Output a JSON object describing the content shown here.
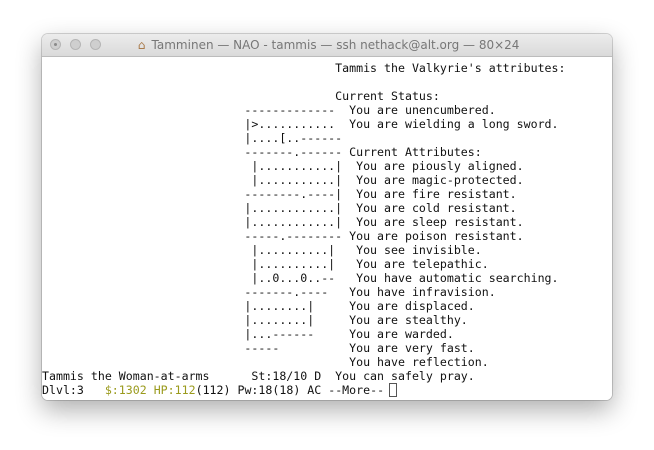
{
  "window": {
    "title": "Tamminen — NAO - tammis — ssh nethack@alt.org — 80×24",
    "title_icon": "home-folder-icon"
  },
  "terminal": {
    "lines": [
      "                                          Tammis the Valkyrie's attributes:",
      "",
      "                                          Current Status:",
      "                             -------------  You are unencumbered.",
      "                             |>...........  You are wielding a long sword.",
      "                             |....[..------",
      "                             -------.------ Current Attributes:",
      "                              |...........|  You are piously aligned.",
      "                              |...........|  You are magic-protected.",
      "                             --------.----|  You are fire resistant.",
      "                             |............|  You are cold resistant.",
      "                             |............|  You are sleep resistant.",
      "                             -----.-------- You are poison resistant.",
      "                              |..........|   You see invisible.",
      "                              |..........|   You are telepathic.",
      "                              |..0...0..--   You have automatic searching.",
      "                             -------.----   You have infravision.",
      "                             |........|     You are displaced.",
      "                             |........|     You are stealthy.",
      "                             |...------     You are warded.",
      "                             -----          You are very fast.",
      "                                            You have reflection.",
      "Tammis the Woman-at-arms      St:18/10 D  You can safely pray."
    ],
    "status": {
      "dlvl": "Dlvl:3   ",
      "gold": "$:1302",
      "hp_label": "HP:112",
      "hp_rest": "(112) Pw:18(18) AC ",
      "more": "--More--"
    },
    "colors": {
      "text": "#111111",
      "highlight": "#9a9a1c",
      "background": "#ffffff"
    }
  }
}
